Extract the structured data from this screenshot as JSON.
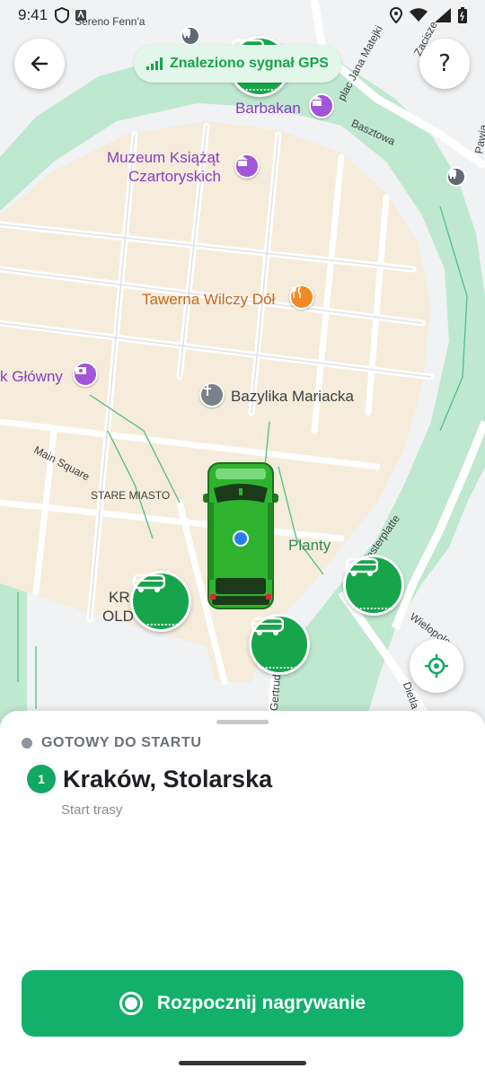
{
  "status_bar": {
    "time": "9:41",
    "top_street_label": "Sereno Fenn'a"
  },
  "header": {
    "gps_status": "Znaleziono sygnał GPS"
  },
  "map": {
    "labels": {
      "barbakan": "Barbakan",
      "museum_line1": "Muzeum Książąt",
      "museum_line2": "Czartoryskich",
      "tavern": "Tawerna Wilczy Dół",
      "rynek": "k Główny",
      "basilica": "Bazylika Mariacka",
      "main_square": "Main Square",
      "stare_miasto": "STARE MIASTO",
      "planty": "Planty",
      "kr": "KR",
      "old": "OLD",
      "basztowa": "Basztowa",
      "matejki": "plac Jana Matejki",
      "zacisze": "Zacisze",
      "pawia": "Pawia",
      "westerplatte": "Westerplatte",
      "wielopole": "Wielopole",
      "gertrudy": "św. Gertrudy",
      "dietla": "Dietla"
    },
    "icons": {
      "barbakan": "museum-icon",
      "museum": "museum-icon",
      "tavern": "restaurant-icon",
      "rynek": "camera-icon",
      "basilica": "church-icon",
      "tram": "tram-icon",
      "bus": "bus-icon"
    }
  },
  "sheet": {
    "status_label": "GOTOWY DO STARTU",
    "stop_number": "1",
    "stop_name": "Kraków, Stolarska",
    "stop_subtitle": "Start trasy",
    "record_button": "Rozpocznij nagrywanie"
  },
  "colors": {
    "accent": "#12b06b",
    "bus_stop": "#17a54b",
    "vehicle": "#2fb32f",
    "park": "#bfe8d0"
  }
}
